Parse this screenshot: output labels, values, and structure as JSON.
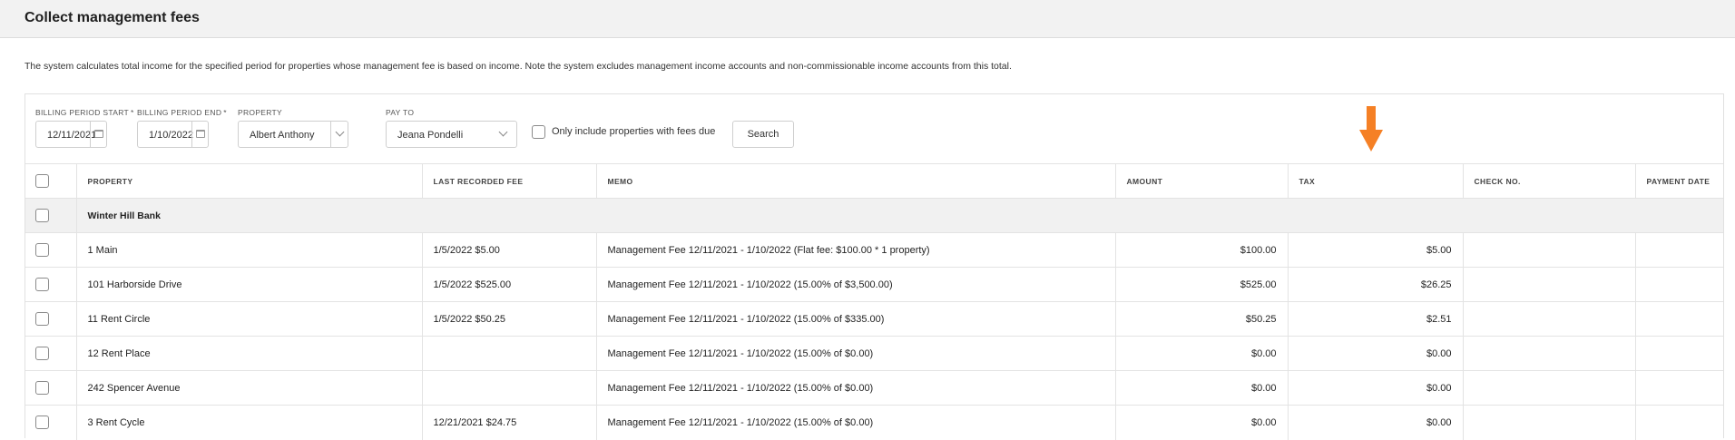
{
  "header": {
    "title": "Collect management fees"
  },
  "description": "The system calculates total income for the specified period for properties whose management fee is based on income. Note the system excludes management income accounts and non-commissionable income accounts from this total.",
  "filters": {
    "billing_start": {
      "label": "Billing period start",
      "required": "*",
      "value": "12/11/2021"
    },
    "billing_end": {
      "label": "Billing period end",
      "required": "*",
      "value": "1/10/2022"
    },
    "property": {
      "label": "Property",
      "value": "Albert Anthony"
    },
    "pay_to": {
      "label": "Pay to",
      "value": "Jeana Pondelli"
    },
    "only_fees_due": {
      "label": "Only include properties with fees due",
      "checked": false
    },
    "search_label": "Search"
  },
  "table": {
    "columns": {
      "property": "Property",
      "last_fee": "Last recorded fee",
      "memo": "Memo",
      "amount": "Amount",
      "tax": "Tax",
      "check_no": "Check No.",
      "payment_date": "Payment date"
    },
    "group": "Winter Hill Bank",
    "rows": [
      {
        "property": "1 Main",
        "last_fee": "1/5/2022 $5.00",
        "memo": "Management Fee 12/11/2021 - 1/10/2022 (Flat fee: $100.00 * 1 property)",
        "amount": "$100.00",
        "tax": "$5.00",
        "check_no": "",
        "payment_date": ""
      },
      {
        "property": "101 Harborside Drive",
        "last_fee": "1/5/2022 $525.00",
        "memo": "Management Fee 12/11/2021 - 1/10/2022 (15.00% of $3,500.00)",
        "amount": "$525.00",
        "tax": "$26.25",
        "check_no": "",
        "payment_date": ""
      },
      {
        "property": "11 Rent Circle",
        "last_fee": "1/5/2022 $50.25",
        "memo": "Management Fee 12/11/2021 - 1/10/2022 (15.00% of $335.00)",
        "amount": "$50.25",
        "tax": "$2.51",
        "check_no": "",
        "payment_date": ""
      },
      {
        "property": "12 Rent Place",
        "last_fee": "",
        "memo": "Management Fee 12/11/2021 - 1/10/2022 (15.00% of $0.00)",
        "amount": "$0.00",
        "tax": "$0.00",
        "check_no": "",
        "payment_date": ""
      },
      {
        "property": "242 Spencer Avenue",
        "last_fee": "",
        "memo": "Management Fee 12/11/2021 - 1/10/2022 (15.00% of $0.00)",
        "amount": "$0.00",
        "tax": "$0.00",
        "check_no": "",
        "payment_date": ""
      },
      {
        "property": "3 Rent Cycle",
        "last_fee": "12/21/2021 $24.75",
        "memo": "Management Fee 12/11/2021 - 1/10/2022 (15.00% of $0.00)",
        "amount": "$0.00",
        "tax": "$0.00",
        "check_no": "",
        "payment_date": ""
      }
    ]
  },
  "colors": {
    "annotation_arrow": "#f58025",
    "header_bg": "#f2f2f2",
    "group_row_bg": "#f1f1f1"
  },
  "icons": {
    "calendar": "calendar-icon",
    "dropdown": "chevron-down-icon",
    "annotation": "arrow-down-icon"
  }
}
